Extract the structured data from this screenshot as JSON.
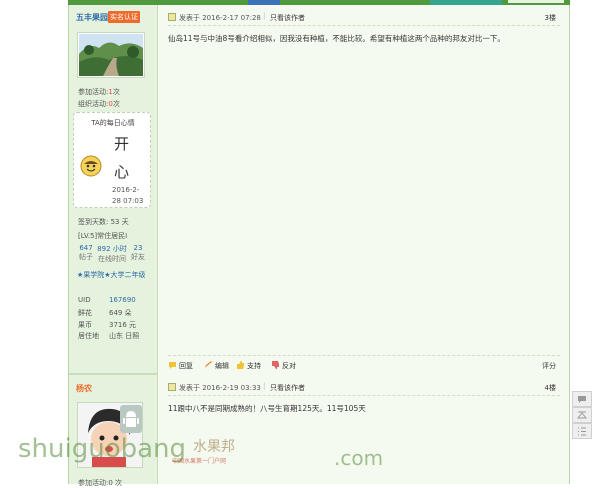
{
  "header": {
    "accent": "#4f9a3f"
  },
  "post1": {
    "author": "五丰果园",
    "verify_badge": "实名认证",
    "stats": {
      "join_label": "参加活动:",
      "join_count": "1",
      "join_unit": "次",
      "org_label": "组织活动:",
      "org_count": "0",
      "org_unit": "次"
    },
    "mood": {
      "title": "TA的每日心情",
      "word1": "开",
      "word2": "心",
      "date1": "2016-2-",
      "date2": "28 07:03",
      "icon": "smiley-face-icon"
    },
    "signin_days": "签到天数: 53 天",
    "level": "[LV.5]常住居民I",
    "counts": [
      {
        "value": "647",
        "label": "帖子"
      },
      {
        "value": "892 小时",
        "label": "在线时间"
      },
      {
        "value": "23",
        "label": "好友"
      }
    ],
    "medal": "★果学院★大学二年级",
    "info": [
      {
        "key": "UID",
        "value": "167690"
      },
      {
        "key": "鲜花",
        "value": "649 朵"
      },
      {
        "key": "果币",
        "value": "3716 元"
      },
      {
        "key": "居住地",
        "value": "山东 日照"
      }
    ],
    "time": "发表于 2016-2-17 07:28",
    "only_author": "只看该作者",
    "floor": "3楼",
    "content": "仙岛11号与中油8号看介绍相似，因我没有种植，不能比较。希望有种植这两个品种的邦友对比一下。",
    "actions": [
      "回复",
      "编辑",
      "支持",
      "反对"
    ],
    "rate": "评分"
  },
  "post2": {
    "author": "杨农",
    "time": "发表于 2016-2-19 03:33",
    "only_author": "只看该作者",
    "floor": "4楼",
    "content": "11跟中八不是同期成熟的！八号生育期125天。11号105天",
    "join_stat": "参加活动:0 次"
  },
  "float_buttons": [
    "comment-icon",
    "back-to-top-icon",
    "list-icon"
  ],
  "watermark": {
    "text": "shuiguobang",
    "dot": ".com",
    "cn": "水果邦",
    "sub": "中国水果第一门户网"
  }
}
